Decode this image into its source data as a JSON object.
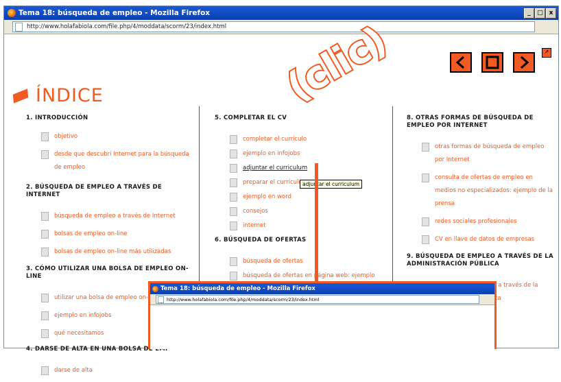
{
  "window": {
    "title": "Tema 18: búsqueda de empleo - Mozilla Firefox",
    "url": "http://www.holafabiola.com/file.php/4/moddata/scorm/23/index.html"
  },
  "nav": {
    "prev_icon": "arrow-left-icon",
    "stop_icon": "square-icon",
    "next_icon": "arrow-right-icon",
    "popup_icon": "popup-icon"
  },
  "heading": "ÍNDICE",
  "columns": [
    {
      "sections": [
        {
          "title": "1. Introducción",
          "items": [
            "objetivo",
            "desde que descubrí Internet para la búsqueda de empleo"
          ]
        },
        {
          "title": "2. Búsqueda de empleo a través de Internet",
          "items": [
            "búsqueda de empleo a través de Internet",
            "bolsas de empleo on-line",
            "bolsas de empleo on-line más utilizadas"
          ]
        },
        {
          "title": "3. Cómo utilizar una bolsa de empleo on-line",
          "items": [
            "utilizar una bolsa de empleo on-line",
            "ejemplo en infojobs",
            "qué necesitamos"
          ]
        },
        {
          "title": "4. Darse de alta en una bolsa de emp",
          "items": [
            "darse de alta"
          ]
        }
      ]
    },
    {
      "sections": [
        {
          "title": "5. Completar el CV",
          "items": [
            "completar el currículo",
            "ejemplo en infojobs",
            "adjuntar el curriculum",
            "preparar el currículo",
            "ejemplo en word",
            "consejos",
            "internet"
          ]
        },
        {
          "title": "6. Búsqueda de ofertas",
          "items": [
            "búsqueda de ofertas",
            "búsqueda de ofertas en página web: ejemplo"
          ]
        }
      ]
    },
    {
      "sections": [
        {
          "title": "8. Otras formas de búsqueda de empleo por Internet",
          "items": [
            "otras formas de búsqueda de empleo por Internet",
            "consulta de ofertas de empleo en medios no especializados: ejemplo de la prensa",
            "redes sociales profesionales",
            "CV en llave de datos de empresas"
          ]
        },
        {
          "title": "9. Búsqueda de empleo a través de la Administración Pública",
          "items": [
            "búsqueda de empleo a través de la Administración Pública"
          ]
        }
      ]
    }
  ],
  "tooltip": "adjuntar el curriculum",
  "callout": "(clic)",
  "popup": {
    "title": "Tema 18: búsqueda de empleo - Mozilla Firefox",
    "url": "http://www.holafabiola.com/file.php/4/moddata/scorm/23/index.html"
  },
  "colors": {
    "accent": "#f15a22",
    "titlebar": "#0b3fae"
  }
}
